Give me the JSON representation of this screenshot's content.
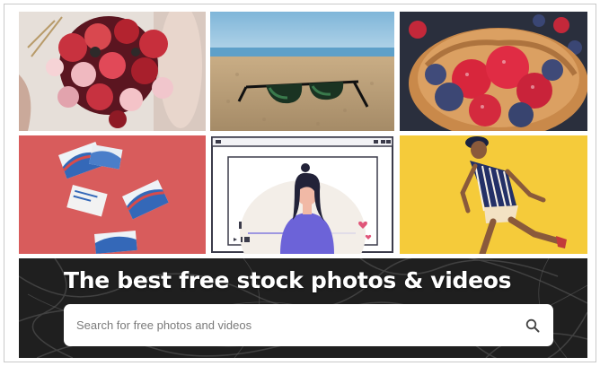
{
  "gallery": {
    "tiles": [
      {
        "name": "bouquet-photo",
        "subject": "bridal bouquet of red and pink roses"
      },
      {
        "name": "sunglasses-on-sand-photo",
        "subject": "sunglasses on beach sand"
      },
      {
        "name": "pancakes-berries-photo",
        "subject": "pancakes with raspberries and blueberries"
      },
      {
        "name": "business-cards-illustration",
        "subject": "scattered cards on red background"
      },
      {
        "name": "video-call-illustration",
        "subject": "woman in video player frame"
      },
      {
        "name": "walking-person-illustration",
        "subject": "person walking on yellow background"
      }
    ]
  },
  "hero": {
    "title": "The best free stock photos & videos",
    "search_placeholder": "Search for free photos and videos",
    "search_icon": "search-icon"
  },
  "colors": {
    "hero_bg": "#1d1d1d",
    "card_red": "#d85c5c",
    "yellow": "#f5cb3a",
    "indigo": "#6c63d8"
  }
}
